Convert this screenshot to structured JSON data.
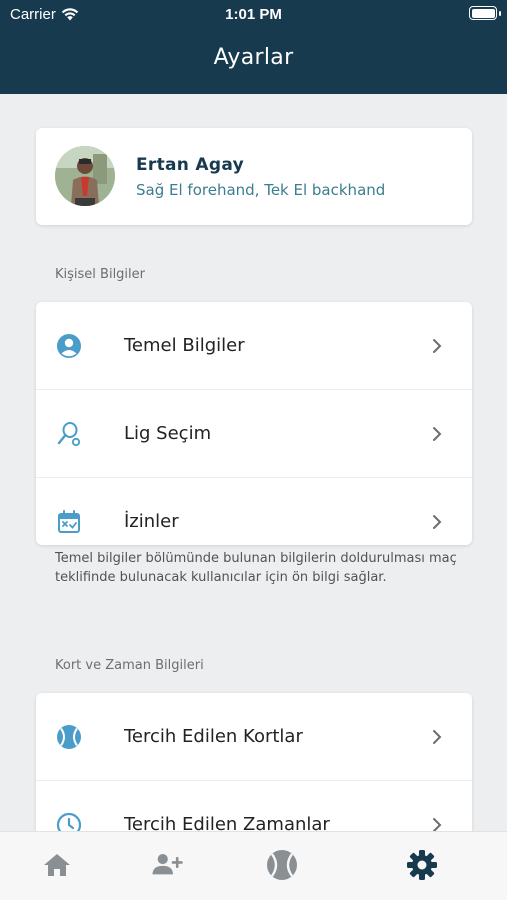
{
  "status_bar": {
    "carrier": "Carrier",
    "time": "1:01 PM"
  },
  "header": {
    "title": "Ayarlar"
  },
  "profile": {
    "name": "Ertan Agay",
    "subtitle": "Sağ El forehand, Tek El backhand"
  },
  "personal_section": {
    "label": "Kişisel Bilgiler",
    "items": [
      {
        "label": "Temel Bilgiler",
        "icon": "user-circle-icon"
      },
      {
        "label": "Lig Seçim",
        "icon": "racket-icon"
      },
      {
        "label": "İzinler",
        "icon": "calendar-x-icon"
      }
    ],
    "footnote": "Temel bilgiler bölümünde bulunan bilgilerin doldurulması maç teklifinde bulunacak kullanıcılar için ön bilgi sağlar."
  },
  "court_section": {
    "label": "Kort ve Zaman Bilgileri",
    "items": [
      {
        "label": "Tercih Edilen Kortlar",
        "icon": "tennis-ball-icon"
      },
      {
        "label": "Tercih Edilen Zamanlar",
        "icon": "clock-icon"
      }
    ]
  },
  "tabbar": {
    "tabs": [
      {
        "name": "home-icon",
        "active": false
      },
      {
        "name": "add-user-icon",
        "active": false
      },
      {
        "name": "tennis-ball-icon",
        "active": false
      },
      {
        "name": "gear-icon",
        "active": true
      }
    ]
  },
  "colors": {
    "header_bg": "#173a4f",
    "accent": "#4a9cc9",
    "active_tab": "#173a4f",
    "inactive_tab": "#8a8f94"
  }
}
